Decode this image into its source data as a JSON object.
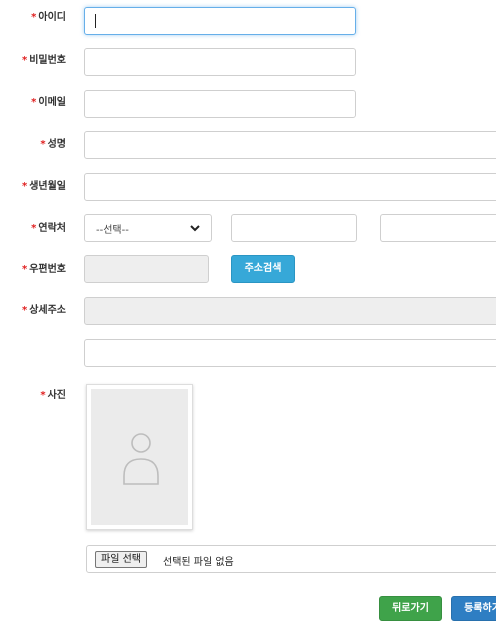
{
  "form": {
    "required_mark": "*",
    "labels": {
      "user_id": "아이디",
      "password": "비밀번호",
      "email": "이메일",
      "name": "성명",
      "birthdate": "생년월일",
      "contact": "연락처",
      "postcode": "우편번호",
      "address": "상세주소",
      "photo": "사진"
    },
    "values": {
      "user_id": "",
      "password": "",
      "email": "",
      "name": "",
      "birthdate": "",
      "phone_mid": "",
      "phone_last": "",
      "postcode": "",
      "address_main": "",
      "address_detail": ""
    },
    "contact_select_value": "--선택--",
    "address_search_label": "주소검색",
    "file_button_label": "파일 선택",
    "file_status": "선택된 파일 없음"
  },
  "actions": {
    "back_label": "뒤로가기",
    "register_label": "등록하기"
  },
  "colors": {
    "required": "#e02020",
    "info_button": "#36a8d8",
    "success_button": "#3fa34a",
    "primary_button": "#2e7ec3"
  },
  "icons": {
    "select_arrow": "chevron-down-icon",
    "photo_placeholder": "user-icon"
  }
}
